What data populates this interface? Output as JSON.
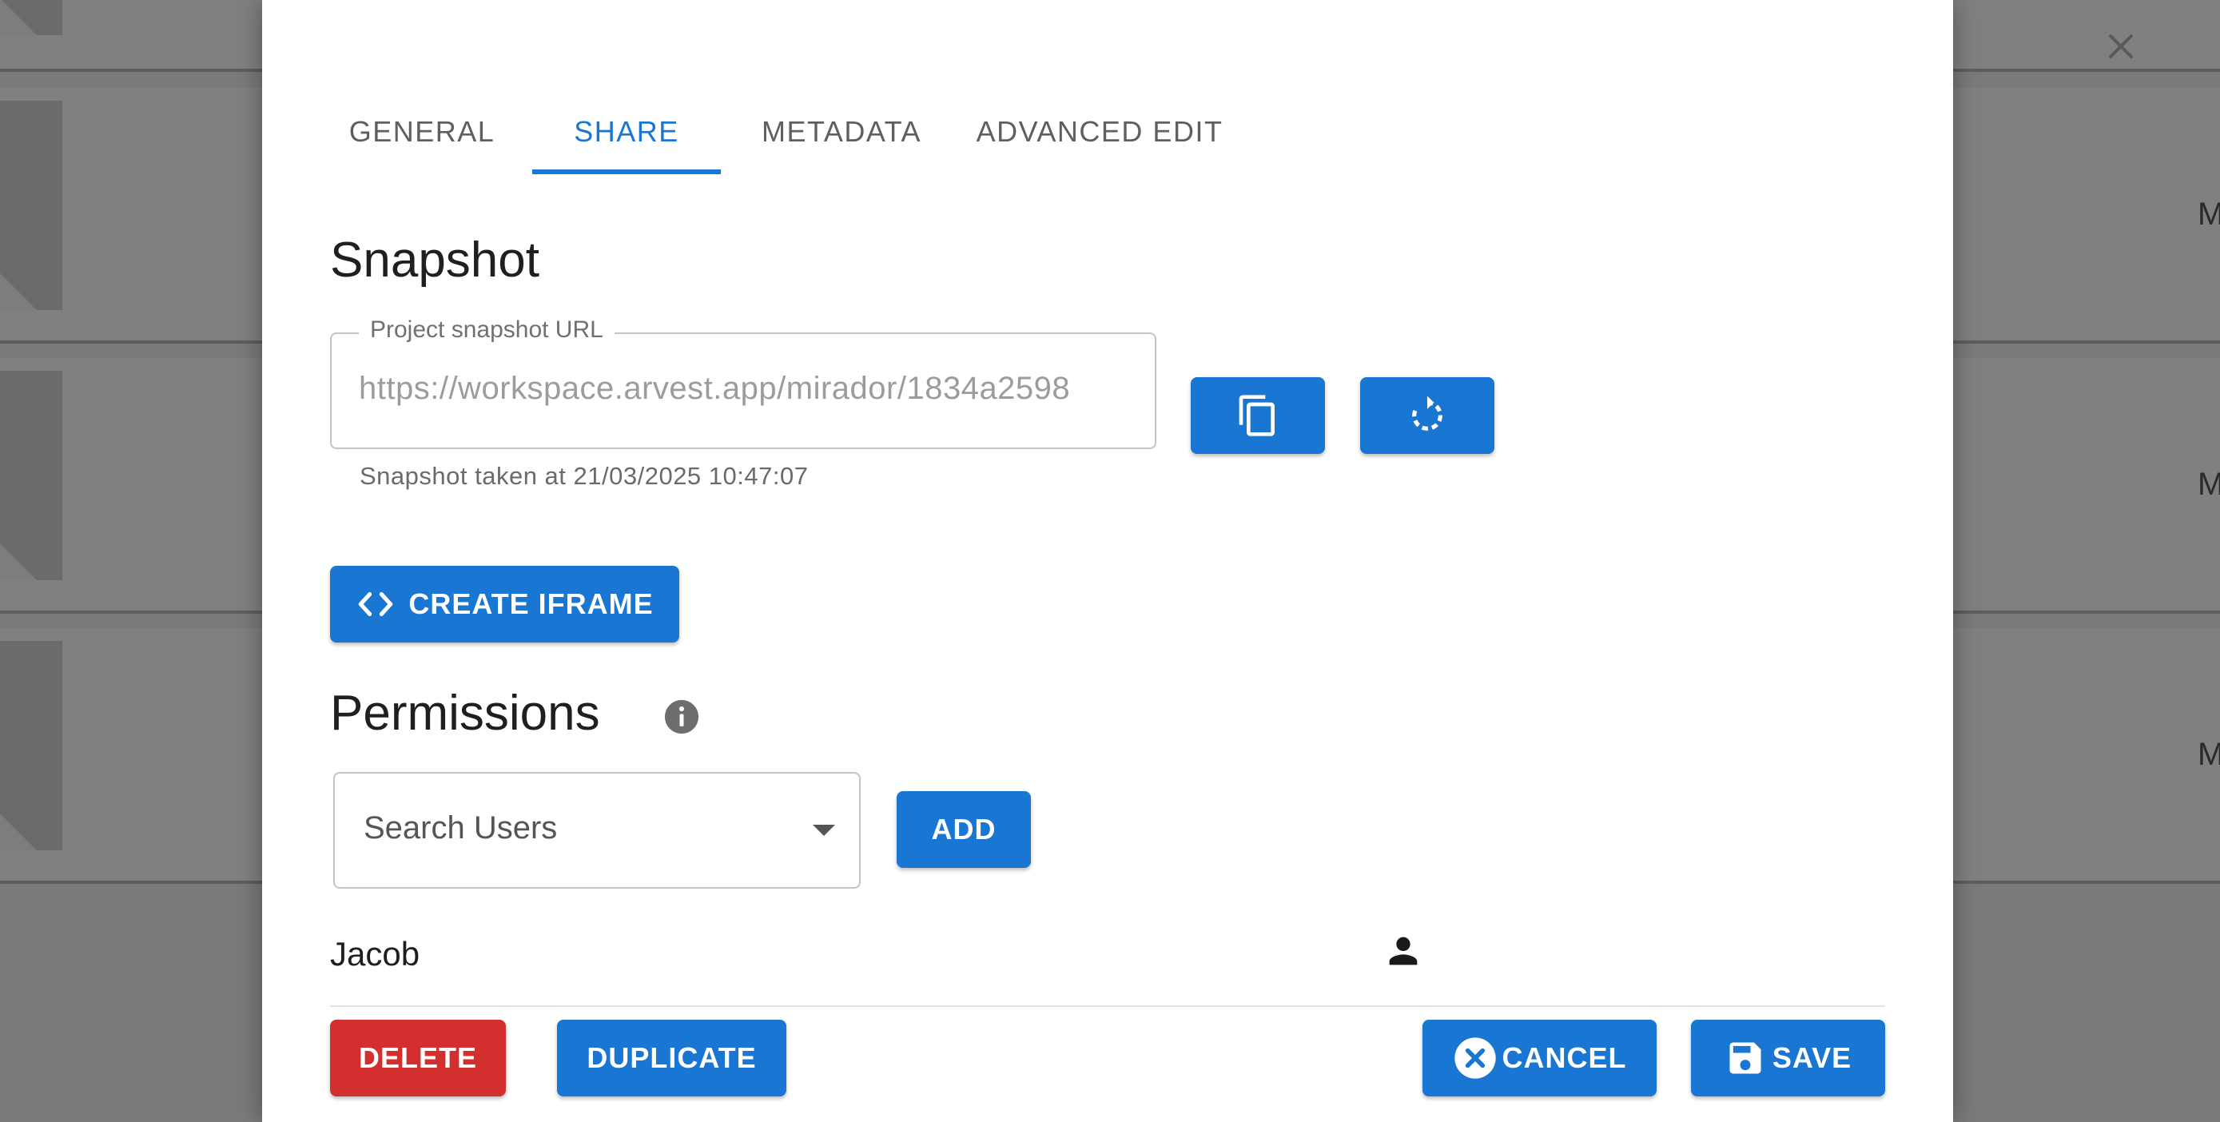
{
  "background": {
    "row_letters": [
      "M",
      "M",
      "M"
    ]
  },
  "dialog": {
    "tabs": [
      {
        "label": "GENERAL",
        "active": false
      },
      {
        "label": "SHARE",
        "active": true
      },
      {
        "label": "METADATA",
        "active": false
      },
      {
        "label": "ADVANCED EDIT",
        "active": false
      }
    ],
    "snapshot": {
      "heading": "Snapshot",
      "url_label": "Project snapshot URL",
      "url_value": "https://workspace.arvest.app/mirador/1834a2598",
      "helper_text": "Snapshot taken at 21/03/2025 10:47:07",
      "copy_icon": "copy-icon",
      "refresh_icon": "refresh-icon"
    },
    "create_iframe_label": "CREATE IFRAME",
    "permissions": {
      "heading": "Permissions",
      "search_placeholder": "Search Users",
      "add_label": "ADD",
      "users": [
        {
          "name": "Jacob",
          "icon": "person-icon"
        }
      ]
    },
    "footer": {
      "delete_label": "DELETE",
      "duplicate_label": "DUPLICATE",
      "cancel_label": "CANCEL",
      "save_label": "SAVE"
    }
  },
  "colors": {
    "primary": "#1976d2",
    "danger": "#d32f2f",
    "overlay": "#7a7a7a"
  }
}
